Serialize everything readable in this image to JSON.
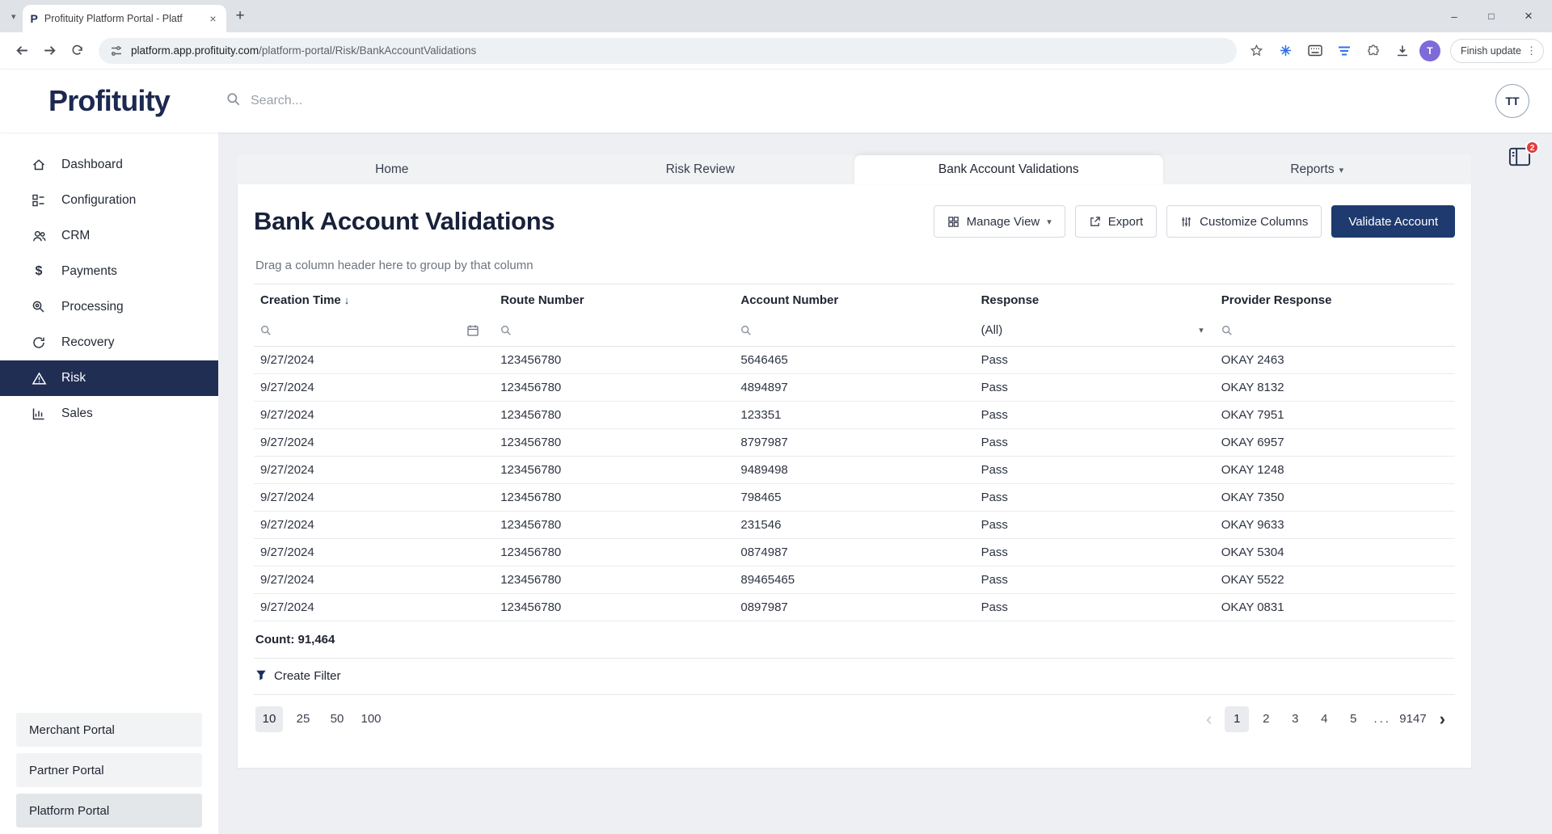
{
  "browser": {
    "favicon": "P",
    "tab_title": "Profituity Platform Portal - Platf",
    "url_domain": "platform.app.profituity.com",
    "url_path": "/platform-portal/Risk/BankAccountValidations",
    "update_button": "Finish update",
    "profile_initial": "T"
  },
  "header": {
    "logo": "Profituity",
    "search_placeholder": "Search...",
    "avatar": "TT"
  },
  "notifications": {
    "count": "2"
  },
  "sidebar": {
    "items": [
      {
        "label": "Dashboard",
        "icon": "home-icon"
      },
      {
        "label": "Configuration",
        "icon": "grid-list-icon"
      },
      {
        "label": "CRM",
        "icon": "people-icon"
      },
      {
        "label": "Payments",
        "icon": "dollar-icon"
      },
      {
        "label": "Processing",
        "icon": "magnifier-gear-icon"
      },
      {
        "label": "Recovery",
        "icon": "refresh-icon"
      },
      {
        "label": "Risk",
        "icon": "warning-triangle-icon",
        "active": true
      },
      {
        "label": "Sales",
        "icon": "bar-chart-icon"
      }
    ],
    "portals": [
      "Merchant Portal",
      "Partner Portal",
      "Platform Portal"
    ],
    "current_portal": "Platform Portal"
  },
  "tabs": [
    "Home",
    "Risk Review",
    "Bank Account Validations",
    "Reports"
  ],
  "active_tab": "Bank Account Validations",
  "page": {
    "title": "Bank Account Validations",
    "toolbar": {
      "manage_view": "Manage View",
      "export": "Export",
      "customize_columns": "Customize Columns",
      "validate_account": "Validate Account"
    },
    "group_hint": "Drag a column header here to group by that column",
    "count_label": "Count: 91,464",
    "create_filter": "Create Filter"
  },
  "table": {
    "columns": [
      "Creation Time",
      "Route Number",
      "Account Number",
      "Response",
      "Provider Response"
    ],
    "sorted_column": "Creation Time",
    "sort_direction": "desc",
    "filter_all": "(All)",
    "rows": [
      {
        "creation_time": "9/27/2024",
        "route_number": "123456780",
        "account_number": "5646465",
        "response": "Pass",
        "provider_response": "OKAY 2463"
      },
      {
        "creation_time": "9/27/2024",
        "route_number": "123456780",
        "account_number": "4894897",
        "response": "Pass",
        "provider_response": "OKAY 8132"
      },
      {
        "creation_time": "9/27/2024",
        "route_number": "123456780",
        "account_number": "123351",
        "response": "Pass",
        "provider_response": "OKAY 7951"
      },
      {
        "creation_time": "9/27/2024",
        "route_number": "123456780",
        "account_number": "8797987",
        "response": "Pass",
        "provider_response": "OKAY 6957"
      },
      {
        "creation_time": "9/27/2024",
        "route_number": "123456780",
        "account_number": "9489498",
        "response": "Pass",
        "provider_response": "OKAY 1248"
      },
      {
        "creation_time": "9/27/2024",
        "route_number": "123456780",
        "account_number": "798465",
        "response": "Pass",
        "provider_response": "OKAY 7350"
      },
      {
        "creation_time": "9/27/2024",
        "route_number": "123456780",
        "account_number": "231546",
        "response": "Pass",
        "provider_response": "OKAY 9633"
      },
      {
        "creation_time": "9/27/2024",
        "route_number": "123456780",
        "account_number": "0874987",
        "response": "Pass",
        "provider_response": "OKAY 5304"
      },
      {
        "creation_time": "9/27/2024",
        "route_number": "123456780",
        "account_number": "89465465",
        "response": "Pass",
        "provider_response": "OKAY 5522"
      },
      {
        "creation_time": "9/27/2024",
        "route_number": "123456780",
        "account_number": "0897987",
        "response": "Pass",
        "provider_response": "OKAY 0831"
      }
    ]
  },
  "pagination": {
    "page_sizes": [
      "10",
      "25",
      "50",
      "100"
    ],
    "active_size": "10",
    "pages": [
      "1",
      "2",
      "3",
      "4",
      "5",
      "...",
      "9147"
    ],
    "active_page": "1"
  },
  "icons": {
    "caret_down": "▾",
    "sort_desc": "↓",
    "chevron_left": "‹",
    "chevron_right": "›",
    "dots_vertical": "⋮",
    "close": "×",
    "minimize": "–",
    "maximize": "□",
    "new_tab": "+",
    "dollar": "$"
  },
  "colors": {
    "brand_navy": "#1e2f5a",
    "primary_button": "#1e3a6e",
    "badge_red": "#e23b3b"
  }
}
